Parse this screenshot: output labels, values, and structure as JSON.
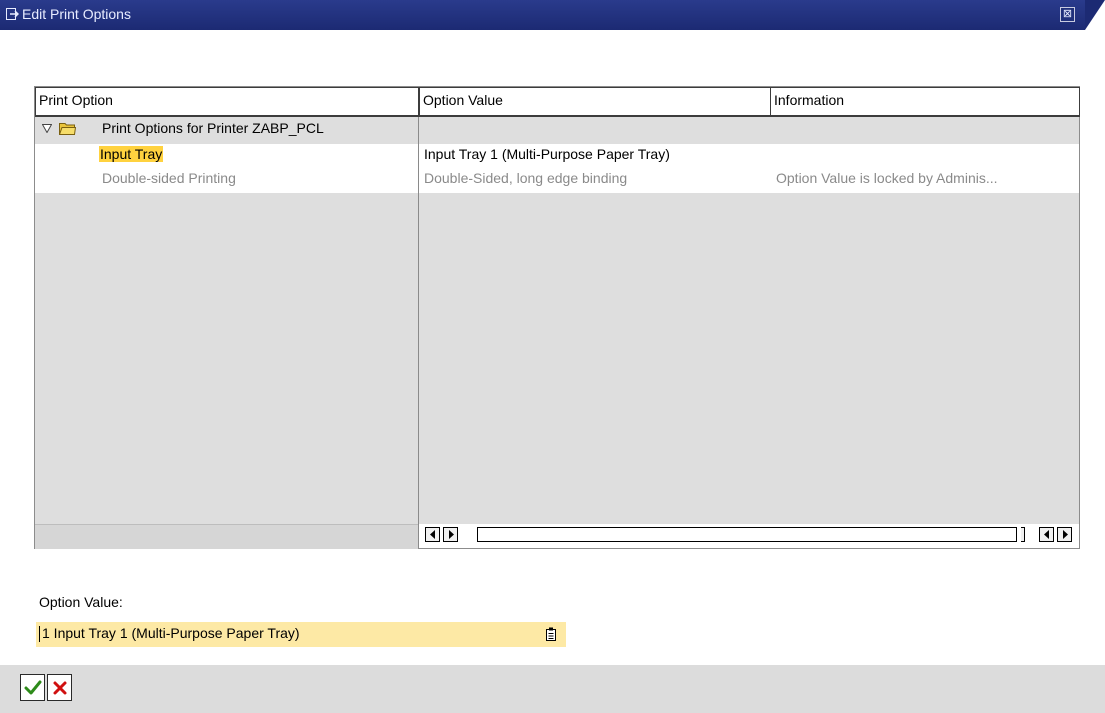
{
  "window": {
    "title": "Edit Print Options",
    "close_glyph": "⊠",
    "icons": [
      "dialog-edit-icon",
      "window-close-icon"
    ]
  },
  "table": {
    "columns": [
      "Print Option",
      "Option Value",
      "Information"
    ],
    "tree_root": {
      "label": "Print Options for Printer ZABP_PCL",
      "icons": [
        "triangle-down-icon",
        "folder-icon"
      ]
    },
    "rows": [
      {
        "option": "Input Tray",
        "value": "Input Tray 1 (Multi-Purpose Paper Tray)",
        "information": "",
        "state": "selected"
      },
      {
        "option": "Double-sided Printing",
        "value": "Double-Sided, long edge binding",
        "information": "Option Value is locked by Adminis...",
        "state": "locked"
      }
    ],
    "scroll_icons": [
      "scroll-left-icon",
      "scroll-right-icon"
    ]
  },
  "option_value": {
    "label": "Option Value:",
    "value": "1 Input Tray 1 (Multi-Purpose Paper Tray)",
    "help_icon": "value-help-icon"
  },
  "footer": {
    "buttons": [
      {
        "name": "confirm",
        "icon": "checkmark-icon",
        "color": "#2e8b1a"
      },
      {
        "name": "cancel",
        "icon": "cross-icon",
        "color": "#d01010"
      }
    ]
  },
  "colors": {
    "titlebar": "#1c2a73",
    "highlight": "#ffd23f",
    "input_bg": "#fde9a5",
    "grid_bg": "#dedede"
  }
}
